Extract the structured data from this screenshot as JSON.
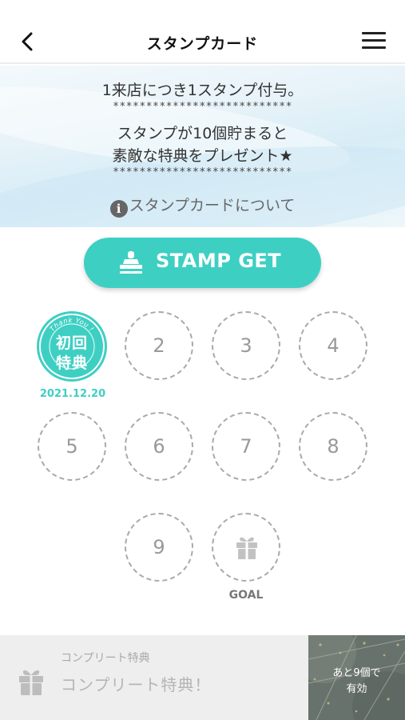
{
  "header": {
    "title": "スタンプカード",
    "back_icon": "chevron-left-icon",
    "menu_icon": "hamburger-menu-icon"
  },
  "banner": {
    "line1": "1来店につき1スタンプ付与。",
    "stars1": "***************************",
    "line2": "スタンプが10個貯まると",
    "line3": "素敵な特典をプレゼント★",
    "stars2": "***************************",
    "about_link": "スタンプカードについて",
    "info_icon": "info-icon"
  },
  "stamp_button": {
    "label": "STAMP GET",
    "icon": "stamp-icon"
  },
  "stamps": {
    "first": {
      "ring_text": "Thank You !",
      "line1": "初回",
      "line2": "特典",
      "date": "2021.12.20"
    },
    "slots": [
      "2",
      "3",
      "4",
      "5",
      "6",
      "7",
      "8",
      "9"
    ],
    "goal_label": "GOAL",
    "goal_icon": "gift-icon"
  },
  "complete": {
    "small_label": "コンプリート特典",
    "main_label": "コンプリート特典！",
    "gift_icon": "gift-icon",
    "remaining_line1": "あと9個で",
    "remaining_line2": "有効"
  },
  "colors": {
    "accent": "#3ecfc3",
    "dashed_border": "#a9a9a9"
  }
}
